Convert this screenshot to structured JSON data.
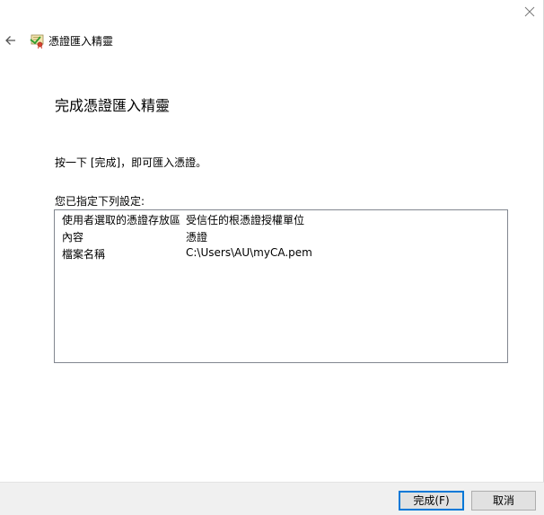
{
  "header": {
    "title": "憑證匯入精靈",
    "back_icon": "back-arrow-icon",
    "wizard_icon": "certificate-wizard-icon",
    "close_icon": "close-icon"
  },
  "main": {
    "title": "完成憑證匯入精靈",
    "instruction": "按一下 [完成]，即可匯入憑證。",
    "settings_label": "您已指定下列設定:",
    "settings": [
      {
        "key": "使用者選取的憑證存放區",
        "value": "受信任的根憑證授權單位"
      },
      {
        "key": "內容",
        "value": "憑證"
      },
      {
        "key": "檔案名稱",
        "value": "C:\\Users\\AU\\myCA.pem"
      }
    ]
  },
  "footer": {
    "finish_label": "完成(F)",
    "cancel_label": "取消"
  },
  "colors": {
    "accent": "#0078d7",
    "footer_bg": "#f0f0f0",
    "button_bg": "#e1e1e1"
  }
}
